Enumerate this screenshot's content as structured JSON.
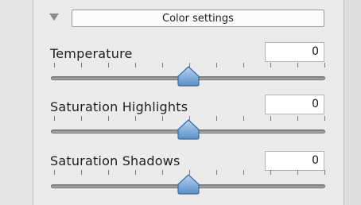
{
  "section": {
    "title": "Color settings",
    "expanded": true
  },
  "controls": [
    {
      "label": "Temperature",
      "value": "0"
    },
    {
      "label": "Saturation Highlights",
      "value": "0"
    },
    {
      "label": "Saturation Shadows",
      "value": "0"
    }
  ],
  "slider": {
    "position_fraction": 0.5,
    "tick_count": 11
  },
  "colors": {
    "thumb_top": "#b9d5f0",
    "thumb_bottom": "#5a8fc8",
    "thumb_border": "#3a6a9e"
  }
}
